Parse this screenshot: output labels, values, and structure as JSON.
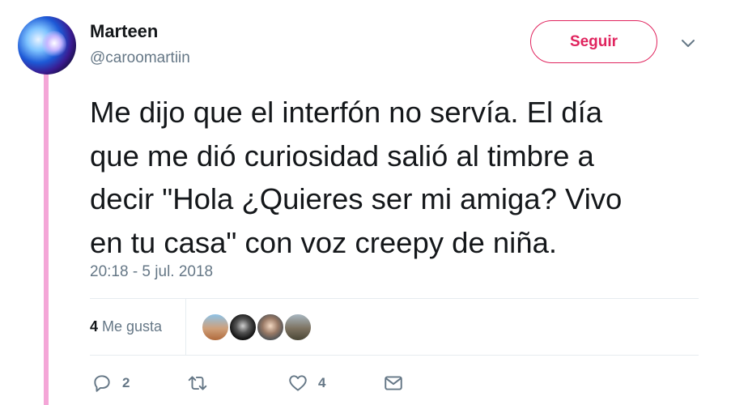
{
  "user": {
    "name": "Marteen",
    "handle": "@caroomartiin"
  },
  "follow_button": {
    "label": "Seguir"
  },
  "tweet": {
    "lines": [
      "Me dijo que el interfón no servía. El día",
      "que me dió curiosidad salió al timbre a",
      "decir \"Hola ¿Quieres ser mi amiga? Vivo",
      "en tu casa\" con voz creepy de niña."
    ],
    "timestamp": "20:18 - 5 jul. 2018"
  },
  "stats": {
    "likes_count": "4",
    "likes_label": "Me gusta"
  },
  "actions": {
    "replies": "2",
    "likes": "4"
  },
  "colors": {
    "accent": "#e0245e",
    "thread_line": "#f4a6d7",
    "secondary_text": "#657786"
  }
}
